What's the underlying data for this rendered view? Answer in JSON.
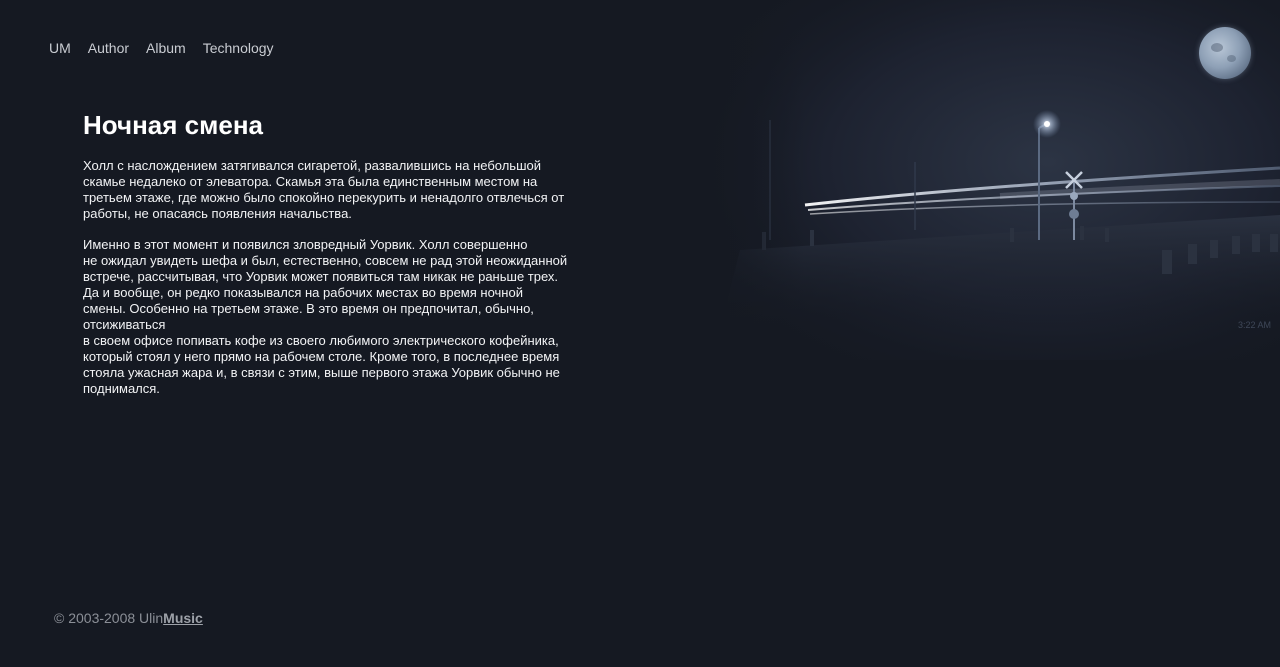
{
  "nav": {
    "items": [
      {
        "label": "UM"
      },
      {
        "label": "Author"
      },
      {
        "label": "Album"
      },
      {
        "label": "Technology"
      }
    ]
  },
  "article": {
    "title": "Ночная смена",
    "paragraphs": [
      "Холл с наслождением затягивался сигаретой, развалившись на небольшой\nскамье недалеко от элеватора. Скамья эта была единственным местом на\nтретьем этаже, где можно было спокойно перекурить и ненадолго отвлечься от\nработы, не опасаясь появления начальства.",
      "Именно в этот момент и появился зловредный Уорвик. Холл совершенно\nне ожидал увидеть шефа и был, естественно, совсем не рад этой неожиданной\nвстрече, рассчитывая, что Уорвик может появиться там никак не раньше трех.\nДа и вообще, он редко показывался на рабочих местах во время ночной\nсмены. Особенно на третьем этаже. В это время он предпочитал, обычно,\nотсиживаться\nв своем офисе попивать кофе из своего любимого электрического кофейника,\nкоторый стоял у него прямо на рабочем столе. Кроме того, в последнее время\nстояла ужасная жара и, в связи с этим, выше первого этажа Уорвик обычно не\nподнимался."
    ]
  },
  "photo": {
    "time_label": "3:22 AM"
  },
  "footer": {
    "copyright": "© 2003-2008 Ulin",
    "link_label": "Music"
  },
  "colors": {
    "background": "#151922",
    "text": "#f2f3f5",
    "nav_text": "#c9ccd2",
    "footer_text": "#8b8f97"
  },
  "icons": {
    "moon": "moon-icon",
    "streetlight": "streetlight-icon",
    "crossing_sign": "railway-crossing-icon"
  }
}
